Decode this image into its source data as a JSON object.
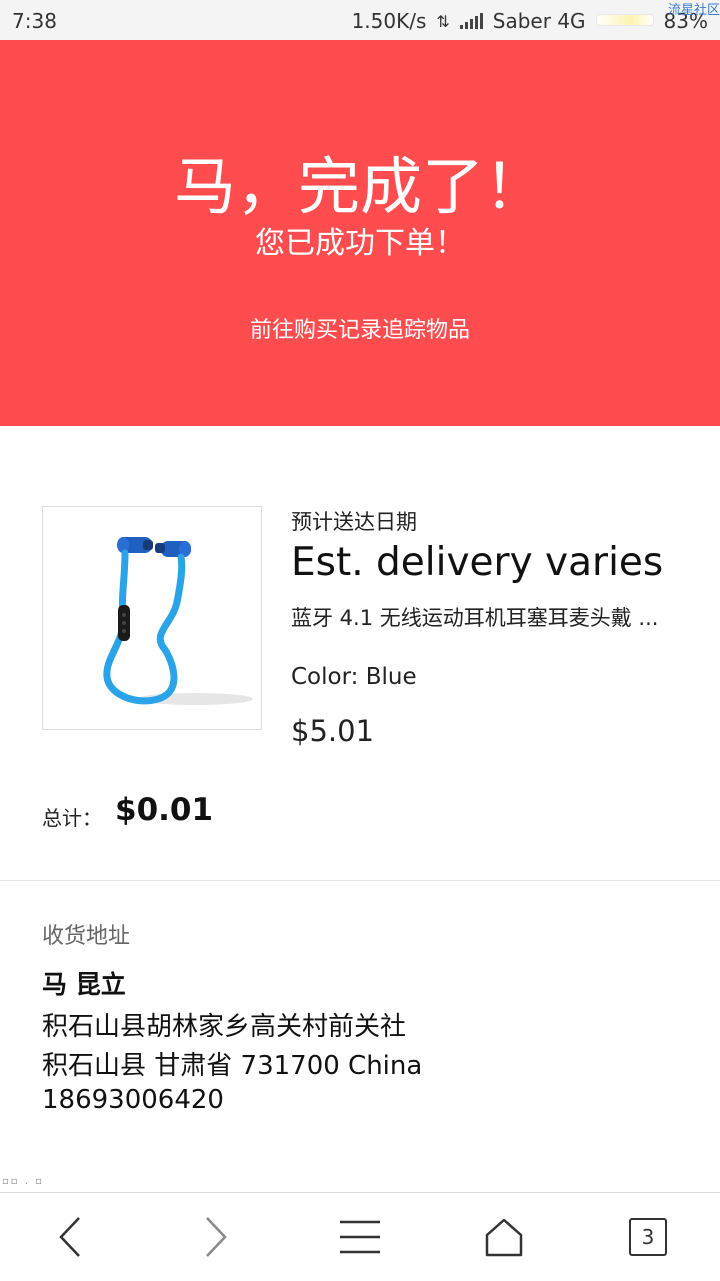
{
  "status_bar": {
    "time": "7:38",
    "network_speed": "1.50K/s",
    "carrier": "Saber 4G",
    "battery": "83%",
    "watermark": "流星社区"
  },
  "hero": {
    "title": "马，完成了！",
    "subtitle": "您已成功下单！",
    "link": "前往购买记录追踪物品",
    "color": "#ff4d4f"
  },
  "product": {
    "delivery_label": "预计送达日期",
    "delivery_value": "Est. delivery varies",
    "name": "蓝牙 4.1 无线运动耳机耳塞耳麦头戴 ...",
    "color": "Color: Blue",
    "price": "$5.01",
    "image_icon": "bluetooth-earphones-image"
  },
  "total": {
    "label": "总计：",
    "value": "$0.01"
  },
  "address": {
    "heading": "收货地址",
    "name": "马 昆立",
    "line1": "积石山县胡林家乡高关村前关社",
    "line2": "积石山县 甘肃省 731700 China",
    "phone": "18693006420"
  },
  "bottom_nav": {
    "tabs_count": "3",
    "icons": [
      "back-icon",
      "forward-icon",
      "menu-icon",
      "home-icon",
      "tabs-icon"
    ]
  }
}
